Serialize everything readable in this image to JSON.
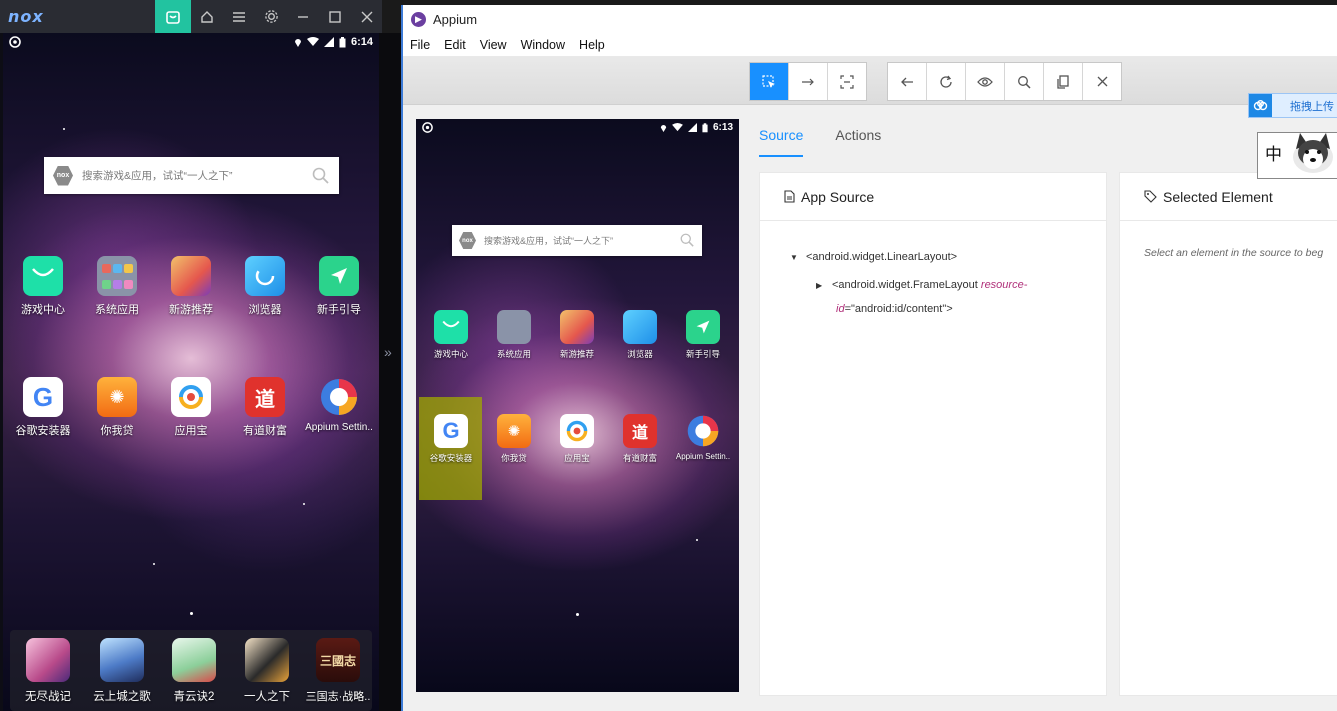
{
  "nox": {
    "logo": "nox",
    "titlebar_icons": [
      "store-icon",
      "home-icon",
      "menu-icon",
      "settings-icon",
      "minimize-icon",
      "maximize-icon",
      "close-icon"
    ],
    "status": {
      "time": "6:14"
    },
    "search": {
      "placeholder": "搜索游戏&应用，试试“一人之下”",
      "badge": "nox"
    },
    "apps_row1": [
      "游戏中心",
      "系统应用",
      "新游推荐",
      "浏览器",
      "新手引导"
    ],
    "apps_row2": [
      "谷歌安装器",
      "你我贷",
      "应用宝",
      "有道财富",
      "Appium Settin.."
    ],
    "dock": [
      "无尽战记",
      "云上城之歌",
      "青云诀2",
      "一人之下",
      "三国志·战略.."
    ]
  },
  "appium": {
    "title": "Appium",
    "menu": [
      "File",
      "Edit",
      "View",
      "Window",
      "Help"
    ],
    "tabs": {
      "source": "Source",
      "actions": "Actions"
    },
    "device": {
      "time": "6:13",
      "search_placeholder": "搜索游戏&应用，试试“一人之下”",
      "search_badge": "nox",
      "apps_row1": [
        "游戏中心",
        "系统应用",
        "新游推荐",
        "浏览器",
        "新手引导"
      ],
      "apps_row2": [
        "谷歌安装器",
        "你我贷",
        "应用宝",
        "有道财富",
        "Appium Settin.."
      ]
    },
    "source_panel": {
      "title": "App Source",
      "node1": "<android.widget.LinearLayout>",
      "node2_open": "<android.widget.FrameLayout ",
      "node2_attr": "resource-",
      "node2_attr2": "id",
      "node2_eq": "=",
      "node2_val": "\"android:id/content\"",
      "node2_close": ">"
    },
    "element_panel": {
      "title": "Selected Element",
      "hint": "Select an element in the source to beg"
    }
  },
  "widgets": {
    "upload_label": "拖拽上传",
    "ime_char": "中"
  },
  "colors": {
    "appium_accent": "#1890ff",
    "nox_accent": "#22c3a0",
    "highlight": "#a0aa00"
  }
}
